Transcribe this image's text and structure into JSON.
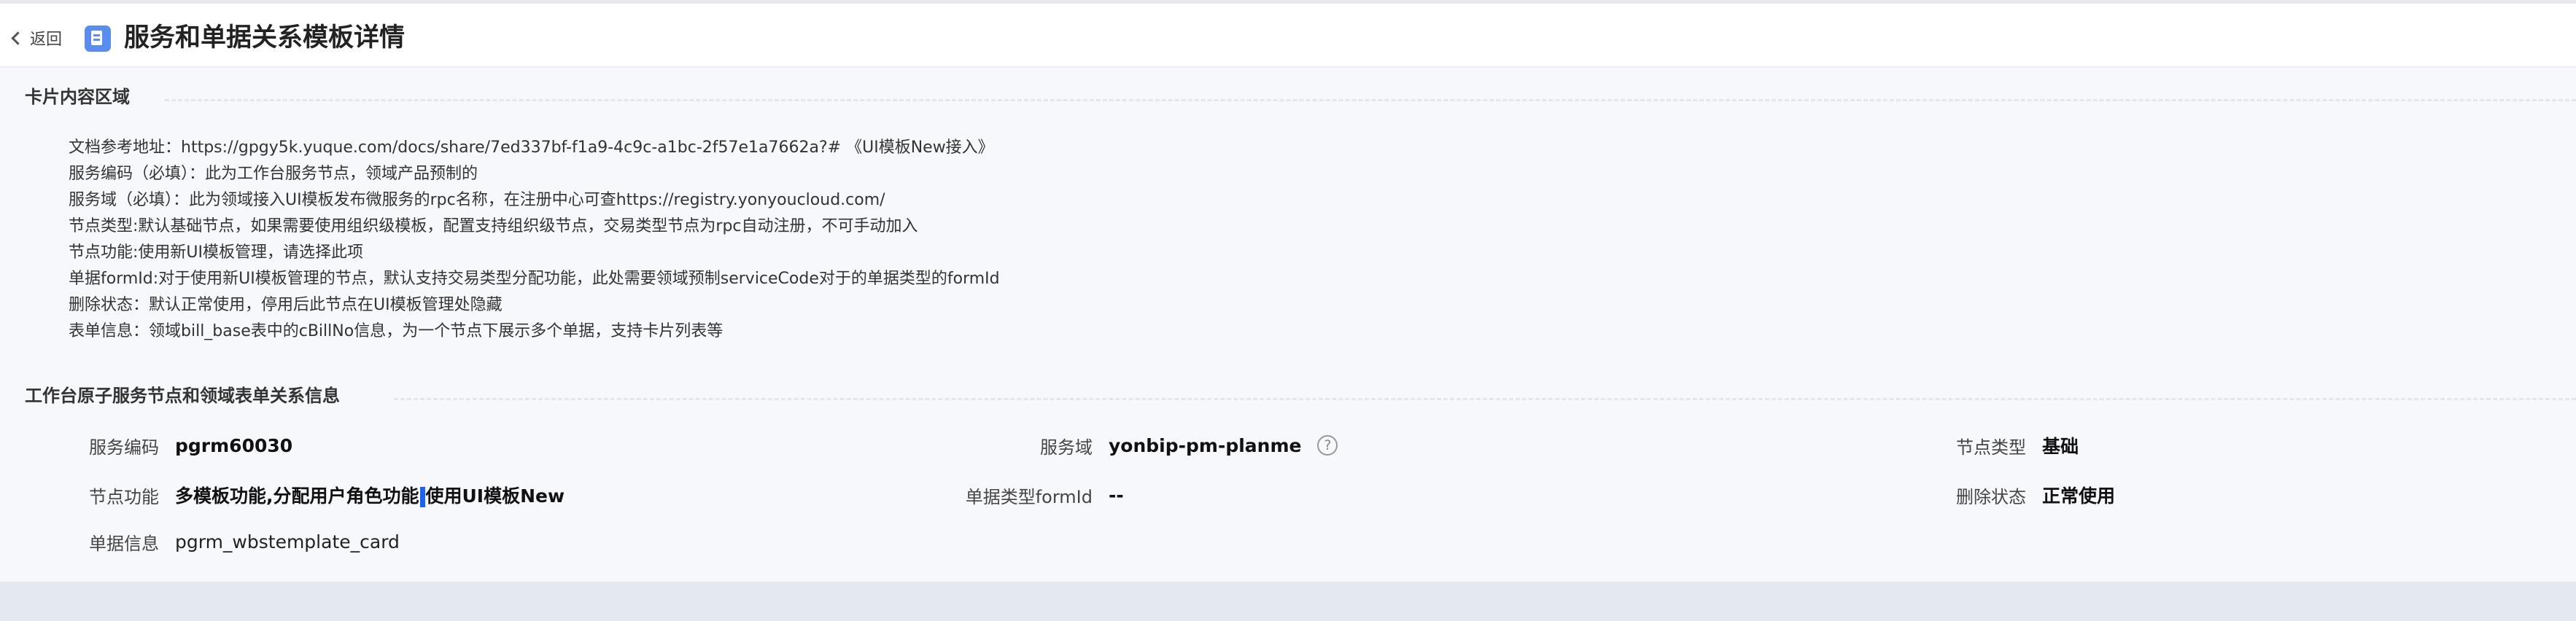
{
  "header": {
    "back_label": "返回",
    "title": "服务和单据关系模板详情"
  },
  "card_section": {
    "title": "卡片内容区域",
    "notes": [
      "文档参考地址：https://gpgy5k.yuque.com/docs/share/7ed337bf-f1a9-4c9c-a1bc-2f57e1a7662a?# 《UI模板New接入》",
      "服务编码（必填）：此为工作台服务节点，领域产品预制的",
      "服务域（必填）：此为领域接入UI模板发布微服务的rpc名称，在注册中心可查https://registry.yonyoucloud.com/",
      "节点类型:默认基础节点，如果需要使用组织级模板，配置支持组织级节点，交易类型节点为rpc自动注册，不可手动加入",
      "节点功能:使用新UI模板管理，请选择此项",
      "单据formId:对于使用新UI模板管理的节点，默认支持交易类型分配功能，此处需要领域预制serviceCode对于的单据类型的formId",
      "删除状态：默认正常使用，停用后此节点在UI模板管理处隐藏",
      "表单信息：领域bill_base表中的cBillNo信息，为一个节点下展示多个单据，支持卡片列表等"
    ]
  },
  "relation_section": {
    "title": "工作台原子服务节点和领域表单关系信息",
    "fields": {
      "service_code": {
        "label": "服务编码",
        "value": "pgrm60030"
      },
      "service_domain": {
        "label": "服务域",
        "value": "yonbip-pm-planme",
        "help_icon": "question-circle-icon"
      },
      "node_type": {
        "label": "节点类型",
        "value": "基础"
      },
      "node_function": {
        "label": "节点功能",
        "value_part1": "多模板功能,分配用户角色功能",
        "value_part2": "使用UI模板New"
      },
      "bill_formid": {
        "label": "单据类型formId",
        "value": "--"
      },
      "delete_status": {
        "label": "删除状态",
        "value": "正常使用"
      },
      "bill_info": {
        "label": "单据信息",
        "value": "pgrm_wbstemplate_card"
      }
    }
  },
  "colors": {
    "accent": "#5b8def",
    "selection_caret": "#1e63f0",
    "page_bg": "#f7f8fb"
  }
}
